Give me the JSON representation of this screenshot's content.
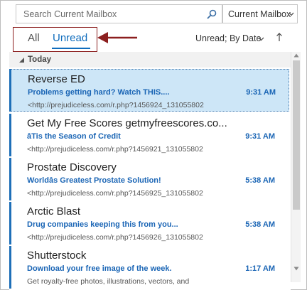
{
  "search": {
    "placeholder": "Search Current Mailbox",
    "icon": "search-icon",
    "scope_label": "Current Mailbox"
  },
  "filters": {
    "all_label": "All",
    "unread_label": "Unread",
    "active": "Unread",
    "sort_label": "Unread; By Date"
  },
  "group": {
    "label": "Today"
  },
  "messages": [
    {
      "sender": "Reverse ED",
      "subject": "Problems getting hard? Watch THIS....",
      "time": "9:31 AM",
      "preview": "<http://prejudiceless.com/r.php?1456924_131055802",
      "selected": true
    },
    {
      "sender": "Get My Free Scores getmyfreescores.co...",
      "subject": "âTis the Season of Credit",
      "time": "9:31 AM",
      "preview": "<http://prejudiceless.com/r.php?1456921_131055802",
      "selected": false
    },
    {
      "sender": "Prostate Discovery",
      "subject": "Worldâs Greatest Prostate Solution!",
      "time": "5:38 AM",
      "preview": "<http://prejudiceless.com/r.php?1456925_131055802",
      "selected": false
    },
    {
      "sender": "Arctic Blast",
      "subject": "Drug companies keeping this from you...",
      "time": "5:38 AM",
      "preview": "<http://prejudiceless.com/r.php?1456926_131055802",
      "selected": false
    },
    {
      "sender": "Shutterstock",
      "subject": "Download your free image of the week.",
      "time": "1:17 AM",
      "preview": "Get royalty-free photos, illustrations, vectors, and",
      "selected": false
    }
  ],
  "colors": {
    "accent": "#0f6cbd",
    "unread_text": "#1a65b5",
    "selected_bg": "#cde6f7",
    "annotation": "#8c1f1f"
  }
}
